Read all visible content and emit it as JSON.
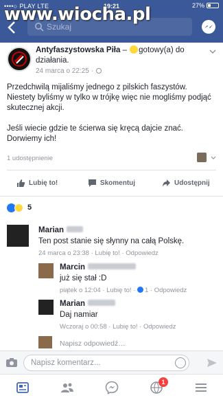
{
  "status_bar": {
    "carrier": "••••○ PLAY  LTE",
    "time": "19:21",
    "battery": "27%"
  },
  "search": {
    "placeholder": "Szukaj"
  },
  "watermark": "www.wiocha.pl",
  "post": {
    "author": "Antyfaszystowska Piła",
    "feeling_prefix": " – ",
    "feeling": "gotowy(a) do działania.",
    "timestamp": "24 marca o 22:25 ·",
    "text": "Przedchwilą mijaliśmy jednego z pilskich faszystów. Niestety byliśmy w tylko w trójkę więc nie mogliśmy podjąć skutecznej akcji.\n\nJeśli wiecie gdzie te ścierwa się kręcą dajcie znać. Dorwiemy ich!",
    "shares": "1 udostępnienie"
  },
  "actions": {
    "like": "Lubię to!",
    "comment": "Skomentuj",
    "share": "Udostępnij"
  },
  "reactions": {
    "count": "5"
  },
  "comments": [
    {
      "name": "Marian",
      "text": "Ten post  stanie się słynny na całą Polskę.",
      "meta": "24 marca o 23:38 · Lubię to! · Odpowiedz"
    },
    {
      "name": "Marcin",
      "text": "już się stał :D",
      "meta": "piątek o 12:04 · Lubię to! · ",
      "likes": "1",
      "reply": " · Odpowiedz"
    },
    {
      "name": "Marian",
      "text": "Daj namiar",
      "meta": "Wczoraj o 00:58 · Lubię to! · Odpowiedz"
    }
  ],
  "reply_prompt": "Napisz odpowiedź…",
  "composer": {
    "placeholder": "Napisz komentarz..."
  },
  "tab_bar": {
    "notifications_badge": "1"
  },
  "colors": {
    "brand": "#3b5998",
    "link": "#2078f4",
    "badge": "#fa3e3e"
  }
}
